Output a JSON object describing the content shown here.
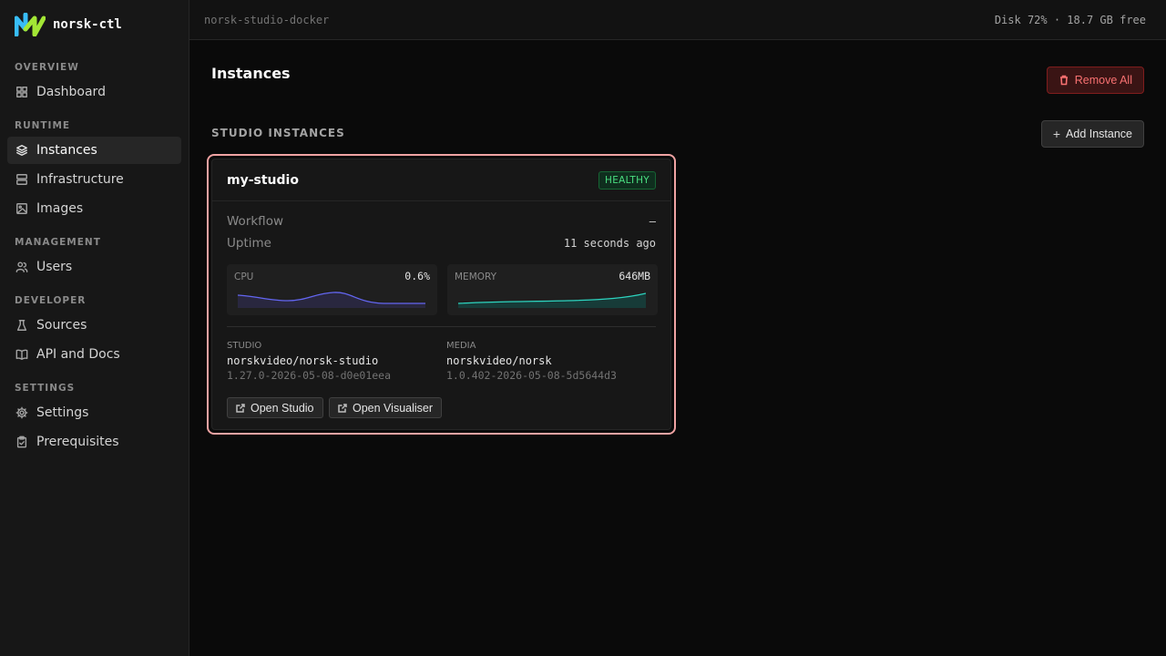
{
  "app": {
    "name": "norsk-ctl"
  },
  "topbar": {
    "context": "norsk-studio-docker",
    "disk": "Disk 72% · 18.7 GB free"
  },
  "sidebar": {
    "sections": [
      {
        "label": "OVERVIEW",
        "items": [
          {
            "label": "Dashboard",
            "icon": "grid-icon"
          }
        ]
      },
      {
        "label": "RUNTIME",
        "items": [
          {
            "label": "Instances",
            "icon": "layers-icon",
            "active": true
          },
          {
            "label": "Infrastructure",
            "icon": "server-icon"
          },
          {
            "label": "Images",
            "icon": "image-icon"
          }
        ]
      },
      {
        "label": "MANAGEMENT",
        "items": [
          {
            "label": "Users",
            "icon": "users-icon"
          }
        ]
      },
      {
        "label": "DEVELOPER",
        "items": [
          {
            "label": "Sources",
            "icon": "flask-icon"
          },
          {
            "label": "API and Docs",
            "icon": "book-icon"
          }
        ]
      },
      {
        "label": "SETTINGS",
        "items": [
          {
            "label": "Settings",
            "icon": "gear-icon"
          },
          {
            "label": "Prerequisites",
            "icon": "clipboard-check-icon"
          }
        ]
      }
    ]
  },
  "main": {
    "title": "Instances",
    "remove_all_label": "Remove All",
    "section_label": "STUDIO INSTANCES",
    "add_instance_label": "Add Instance"
  },
  "instance": {
    "name": "my-studio",
    "status": "HEALTHY",
    "workflow_label": "Workflow",
    "workflow_value": "–",
    "uptime_label": "Uptime",
    "uptime_value": "11 seconds ago",
    "cpu": {
      "label": "CPU",
      "value": "0.6%"
    },
    "memory": {
      "label": "MEMORY",
      "value": "646MB"
    },
    "studio": {
      "caption": "STUDIO",
      "image": "norskvideo/norsk-studio",
      "version": "1.27.0-2026-05-08-d0e01eea"
    },
    "media": {
      "caption": "MEDIA",
      "image": "norskvideo/norsk",
      "version": "1.0.402-2026-05-08-5d5644d3"
    },
    "open_studio_label": "Open Studio",
    "open_visualiser_label": "Open Visualiser"
  },
  "colors": {
    "accent_logo_blue": "#38bdf8",
    "accent_logo_green": "#a3e635",
    "cpu_line": "#6366f1",
    "memory_line": "#2dd4bf",
    "danger": "#f87171",
    "healthy": "#4ade80"
  }
}
